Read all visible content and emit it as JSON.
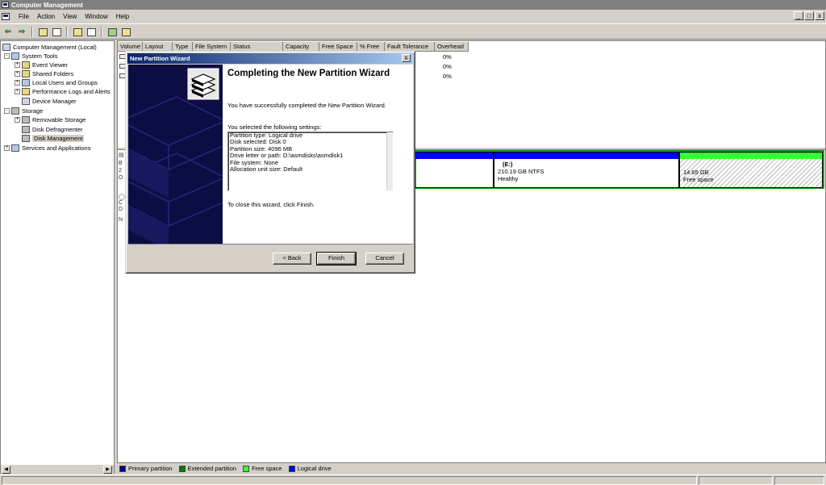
{
  "window": {
    "title": "Computer Management",
    "menu": [
      "File",
      "Action",
      "View",
      "Window",
      "Help"
    ],
    "window_buttons": [
      "_",
      "□",
      "x"
    ]
  },
  "toolbar": {
    "back_icon": "back-arrow-icon",
    "forward_icon": "forward-arrow-icon"
  },
  "tree": {
    "root": "Computer Management (Local)",
    "system_tools": "System Tools",
    "event_viewer": "Event Viewer",
    "shared_folders": "Shared Folders",
    "local_users": "Local Users and Groups",
    "perf_logs": "Performance Logs and Alerts",
    "device_manager": "Device Manager",
    "storage": "Storage",
    "removable_storage": "Removable Storage",
    "disk_defrag": "Disk Defragmenter",
    "disk_management": "Disk Management",
    "services": "Services and Applications"
  },
  "volume_list": {
    "columns": [
      "Volume",
      "Layout",
      "Type",
      "File System",
      "Status",
      "Capacity",
      "Free Space",
      "% Free",
      "Fault Tolerance",
      "Overhead"
    ],
    "overhead_values": [
      "0%",
      "0%",
      "0%"
    ]
  },
  "disk_graphic": {
    "disk0_label_fragments": [
      "B",
      "2",
      "O"
    ],
    "cdrom_label_fragments": [
      "C",
      "D",
      "N"
    ],
    "partition_e": {
      "name": "(E:)",
      "size": "210.19 GB NTFS",
      "status": "Healthy"
    },
    "free_space": {
      "size": "14.65 GB",
      "label": "Free space"
    }
  },
  "legend": [
    {
      "label": "Primary partition",
      "color": "#000080"
    },
    {
      "label": "Extended partition",
      "color": "#008000"
    },
    {
      "label": "Free space",
      "color": "#33ff33"
    },
    {
      "label": "Logical drive",
      "color": "#0000ff"
    }
  ],
  "dialog": {
    "title": "New Partition Wizard",
    "heading": "Completing the New Partition Wizard",
    "success_text": "You have successfully completed the New Partition Wizard.",
    "settings_label": "You selected the following settings:",
    "settings": [
      "Partition type: Logical drive",
      "Disk selected: Disk 0",
      "Partition size: 4096 MB",
      "Drive letter or path: D:\\asmdisks\\asmdisk1",
      "File system: None",
      "Allocation unit size: Default"
    ],
    "close_note": "To close this wizard, click Finish.",
    "back_button": "< Back",
    "finish_button": "Finish",
    "cancel_button": "Cancel",
    "close_glyph": "x"
  }
}
